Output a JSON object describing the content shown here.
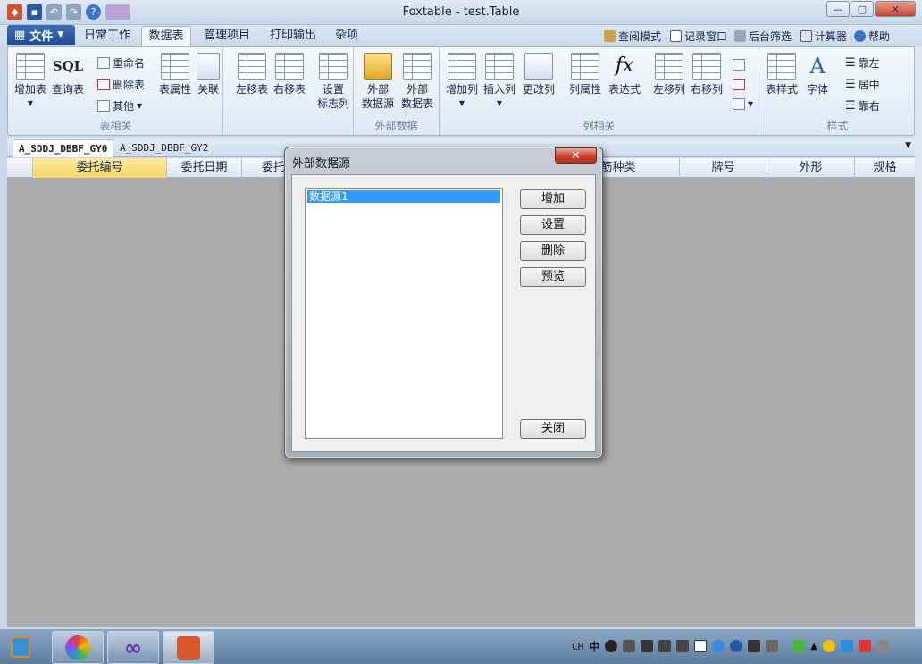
{
  "window": {
    "title": "Foxtable - test.Table",
    "minimize": "—",
    "maximize": "▢",
    "close": "✕"
  },
  "menu": {
    "file": "文件",
    "tabs": [
      "日常工作",
      "数据表",
      "管理项目",
      "打印输出",
      "杂项"
    ],
    "right_links": [
      "查阅模式",
      "记录窗口",
      "后台筛选",
      "计算器",
      "帮助"
    ]
  },
  "ribbon": {
    "group_table": {
      "label": "表相关",
      "add_table": "增加表",
      "query_table": "查询表",
      "sql_icon": "SQL",
      "rename": "重命名",
      "delete_table": "删除表",
      "other": "其他",
      "table_props": "表属性",
      "relation": "关联",
      "move_left": "左移表",
      "move_right": "右移表",
      "flag_col_1": "设置",
      "flag_col_2": "标志列"
    },
    "group_external": {
      "label": "外部数据",
      "ext_source_1": "外部",
      "ext_source_2": "数据源",
      "ext_table_1": "外部",
      "ext_table_2": "数据表"
    },
    "group_column": {
      "label": "列相关",
      "add_col": "增加列",
      "insert_col": "插入列",
      "change_col": "更改列",
      "col_props": "列属性",
      "fx_icon": "fx",
      "expression": "表达式",
      "move_col_left": "左移列",
      "move_col_right": "右移列"
    },
    "group_style": {
      "label": "样式",
      "table_style": "表样式",
      "font": "字体",
      "align_left": "靠左",
      "align_center": "居中",
      "align_right": "靠右"
    }
  },
  "doc_tabs": [
    "A_SDDJ_DBBF_GY0",
    "A_SDDJ_DBBF_GY2"
  ],
  "grid": {
    "columns": [
      "委托编号",
      "委托日期",
      "委托",
      "钢筋种类",
      "牌号",
      "外形",
      "规格"
    ]
  },
  "dialog": {
    "title": "外部数据源",
    "close": "✕",
    "list_items": [
      "数据源1"
    ],
    "buttons": {
      "add": "增加",
      "settings": "设置",
      "delete": "删除",
      "preview": "预览",
      "close": "关闭"
    }
  },
  "tray": {
    "ime": "CH",
    "ime_zh": "中"
  }
}
